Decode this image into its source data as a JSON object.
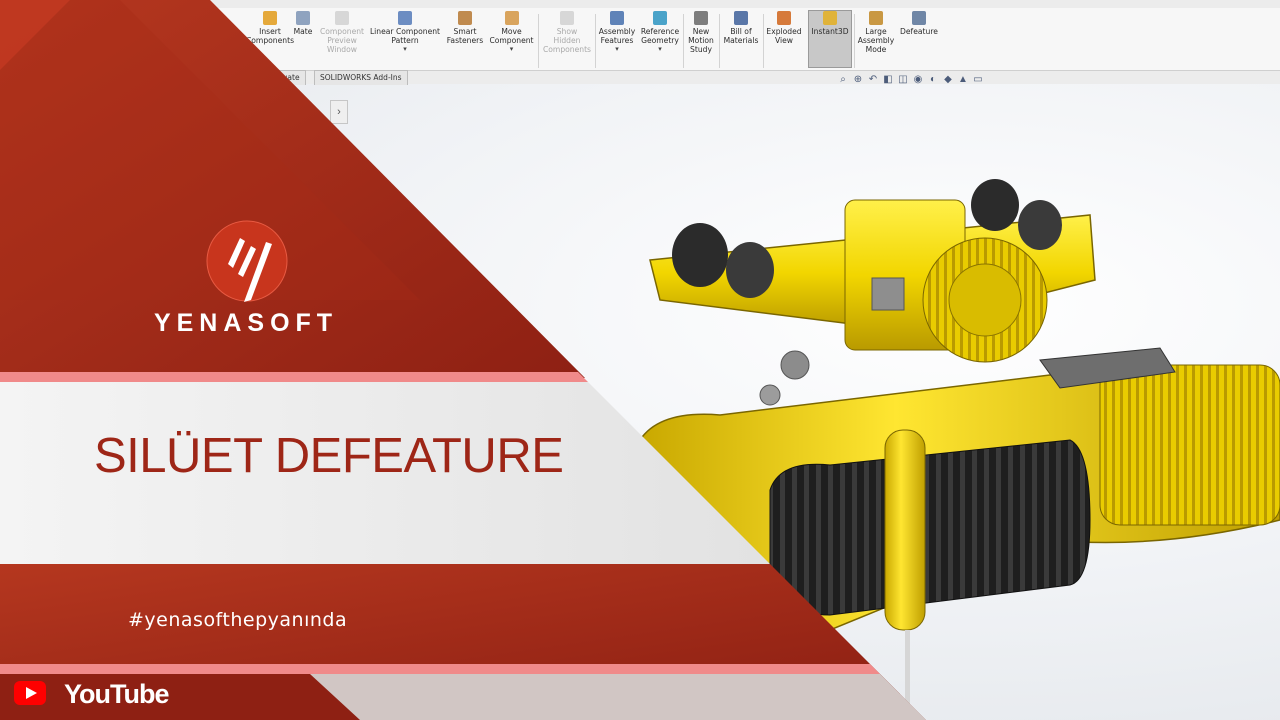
{
  "ribbon": {
    "buttons": [
      {
        "label": "Insert\nComponents",
        "state": "enabled"
      },
      {
        "label": "Mate",
        "state": "enabled"
      },
      {
        "label": "Component\nPreview\nWindow",
        "state": "disabled"
      },
      {
        "label": "Linear Component\nPattern",
        "state": "enabled"
      },
      {
        "label": "Smart\nFasteners",
        "state": "enabled"
      },
      {
        "label": "Move\nComponent",
        "state": "enabled"
      },
      {
        "label": "Show\nHidden\nComponents",
        "state": "disabled"
      },
      {
        "label": "Assembly\nFeatures",
        "state": "enabled"
      },
      {
        "label": "Reference\nGeometry",
        "state": "enabled"
      },
      {
        "label": "New\nMotion\nStudy",
        "state": "enabled"
      },
      {
        "label": "Bill of\nMaterials",
        "state": "enabled"
      },
      {
        "label": "Exploded\nView",
        "state": "enabled"
      },
      {
        "label": "Instant3D",
        "state": "active"
      },
      {
        "label": "Large\nAssembly\nMode",
        "state": "enabled"
      },
      {
        "label": "Defeature",
        "state": "enabled"
      }
    ],
    "tabs": [
      "aluate",
      "SOLIDWORKS Add-Ins"
    ]
  },
  "panel": {
    "expand_glyph": "›"
  },
  "heads_up": [
    "zoom-to-fit-icon",
    "zoom-area-icon",
    "previous-view-icon",
    "section-view-icon",
    "view-orientation-icon",
    "display-style-icon",
    "hide-show-icon",
    "edit-appearance-icon",
    "apply-scene-icon",
    "view-settings-icon"
  ],
  "overlay": {
    "brand": "YENASOFT",
    "title": "SILÜET DEFEATURE",
    "hashtag": "#yenasofthepyanında",
    "youtube": "YouTube"
  },
  "colors": {
    "brand_red": "#9e2617",
    "dark_red": "#7c1a10",
    "light_band": "#eeeeee",
    "accent_pink": "#f08a8a",
    "hoist_yellow": "#f2d600",
    "hoist_shadow": "#b99a00",
    "rope_black": "#1e1e1e"
  }
}
